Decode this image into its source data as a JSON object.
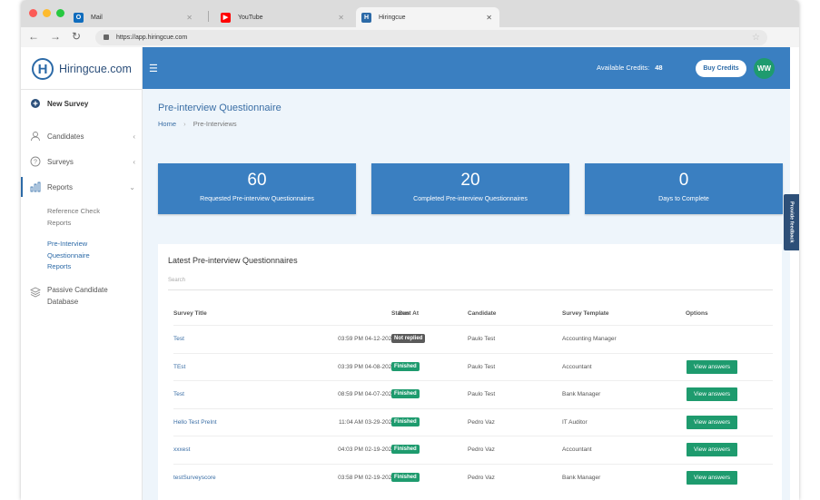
{
  "browser": {
    "tabs": [
      {
        "title": "Mail",
        "icon": "outlook-icon"
      },
      {
        "title": "YouTube",
        "icon": "youtube-icon"
      },
      {
        "title": "Hiringcue",
        "icon": "hiringcue-icon"
      }
    ],
    "url": "https://app.hiringcue.com"
  },
  "logo": {
    "mark": "H",
    "text": "Hiringcue.com"
  },
  "sidebar": {
    "new_survey": "New Survey",
    "items": [
      {
        "label": "Candidates",
        "icon": "candidates-icon"
      },
      {
        "label": "Surveys",
        "icon": "question-icon"
      },
      {
        "label": "Reports",
        "icon": "chart-icon"
      }
    ],
    "reports_sub": [
      {
        "line1": "Reference Check",
        "line2": "Reports",
        "line3": ""
      },
      {
        "line1": "Pre-Interview",
        "line2": "Questionnaire",
        "line3": "Reports"
      }
    ],
    "passive": {
      "line1": "Passive Candidate",
      "line2": "Database"
    }
  },
  "topbar": {
    "credits_label": "Available Credits:",
    "credits_value": "48",
    "buy_label": "Buy Credits",
    "avatar": "WW"
  },
  "page": {
    "title": "Pre-interview Questionnaire",
    "breadcrumb_home": "Home",
    "breadcrumb_current": "Pre-Interviews"
  },
  "stats": [
    {
      "value": "60",
      "label": "Requested Pre-interview Questionnaires"
    },
    {
      "value": "20",
      "label": "Completed Pre-interview Questionnaires"
    },
    {
      "value": "0",
      "label": "Days to Complete"
    }
  ],
  "table": {
    "title": "Latest Pre-interview Questionnaires",
    "search_placeholder": "Search",
    "headers": {
      "survey_title": "Survey Title",
      "sent_at": "Sent At",
      "status": "Status",
      "candidate": "Candidate",
      "template": "Survey Template",
      "options": "Options"
    },
    "rows": [
      {
        "title": "Test",
        "sent": "03:59 PM 04-12-2021",
        "status": "Not replied",
        "candidate": "Paulo Test",
        "template": "Accounting Manager",
        "option": ""
      },
      {
        "title": "TEst",
        "sent": "03:39 PM 04-08-2021",
        "status": "Finished",
        "candidate": "Paulo Test",
        "template": "Accountant",
        "option": "View answers"
      },
      {
        "title": "Test",
        "sent": "08:59 PM 04-07-2021",
        "status": "Finished",
        "candidate": "Paulo Test",
        "template": "Bank Manager",
        "option": "View answers"
      },
      {
        "title": "Hello Test PreInt",
        "sent": "11:04 AM 03-29-2021",
        "status": "Finished",
        "candidate": "Pedro Vaz",
        "template": "IT Auditor",
        "option": "View answers"
      },
      {
        "title": "xxxest",
        "sent": "04:03 PM 02-19-2021",
        "status": "Finished",
        "candidate": "Pedro Vaz",
        "template": "Accountant",
        "option": "View answers"
      },
      {
        "title": "testSurveyscore",
        "sent": "03:58 PM 02-19-2021",
        "status": "Finished",
        "candidate": "Pedro Vaz",
        "template": "Bank Manager",
        "option": "View answers"
      }
    ]
  },
  "feedback_label": "Provide feedback",
  "colors": {
    "primary": "#3a7fc1",
    "finished": "#1e9b6e",
    "not_replied": "#5a5a5a"
  }
}
